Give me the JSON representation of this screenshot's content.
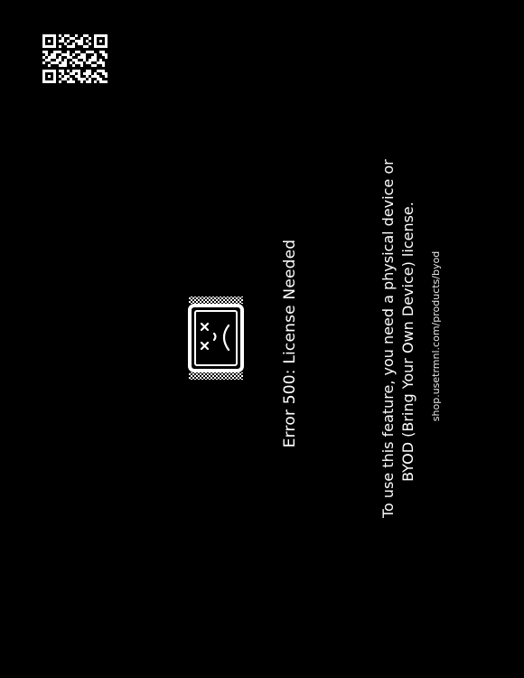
{
  "error": {
    "title": "Error 500: License Needed",
    "message_line1": "To use this feature, you need a physical device or",
    "message_line2": "BYOD (Bring Your Own Device) license.",
    "url": "shop.usetrmnl.com/products/byod"
  },
  "icons": {
    "qr": "qr-code-icon",
    "monitor": "sad-monitor-icon"
  },
  "colors": {
    "background": "#000000",
    "foreground": "#ffffff"
  }
}
